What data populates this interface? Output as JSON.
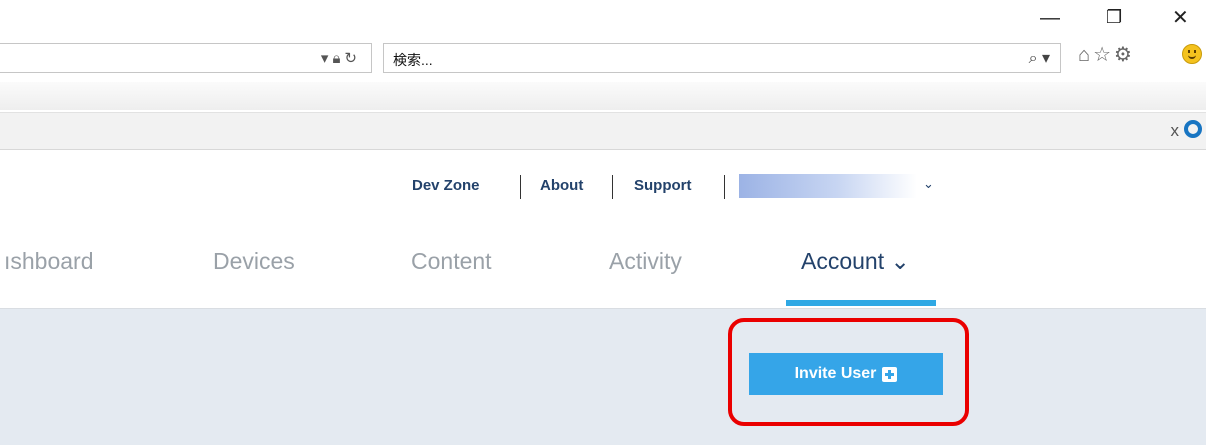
{
  "browser": {
    "window_controls": {
      "minimize": "—",
      "restore": "❐",
      "close": "✕"
    },
    "address_bar": {
      "dropdown_icon": "chevron-down-icon",
      "lock_icon": "lock-icon",
      "refresh_icon": "refresh-icon"
    },
    "search_box": {
      "placeholder": "検索..."
    },
    "toolbar_icons": [
      "home-icon",
      "favorites-star-icon",
      "settings-gear-icon",
      "feedback-smiley-icon"
    ],
    "infobar": {
      "close": "x"
    }
  },
  "utility_nav": {
    "links": [
      "Dev Zone",
      "About",
      "Support"
    ],
    "user_menu_chevron": "⌄"
  },
  "main_nav": {
    "items": [
      {
        "label": "ıshboard"
      },
      {
        "label": "Devices"
      },
      {
        "label": "Content"
      },
      {
        "label": "Activity"
      },
      {
        "label": "Account ⌄"
      }
    ],
    "active": "Account"
  },
  "actions": {
    "invite_user_label": "Invite User"
  },
  "colors": {
    "accent": "#35a5e8",
    "active_tab_bar": "#2fa8e4",
    "nav_text": "#23426b",
    "inactive_nav": "#9aa1a8",
    "content_bg": "#e4eaf1",
    "highlight": "#ea0000"
  }
}
